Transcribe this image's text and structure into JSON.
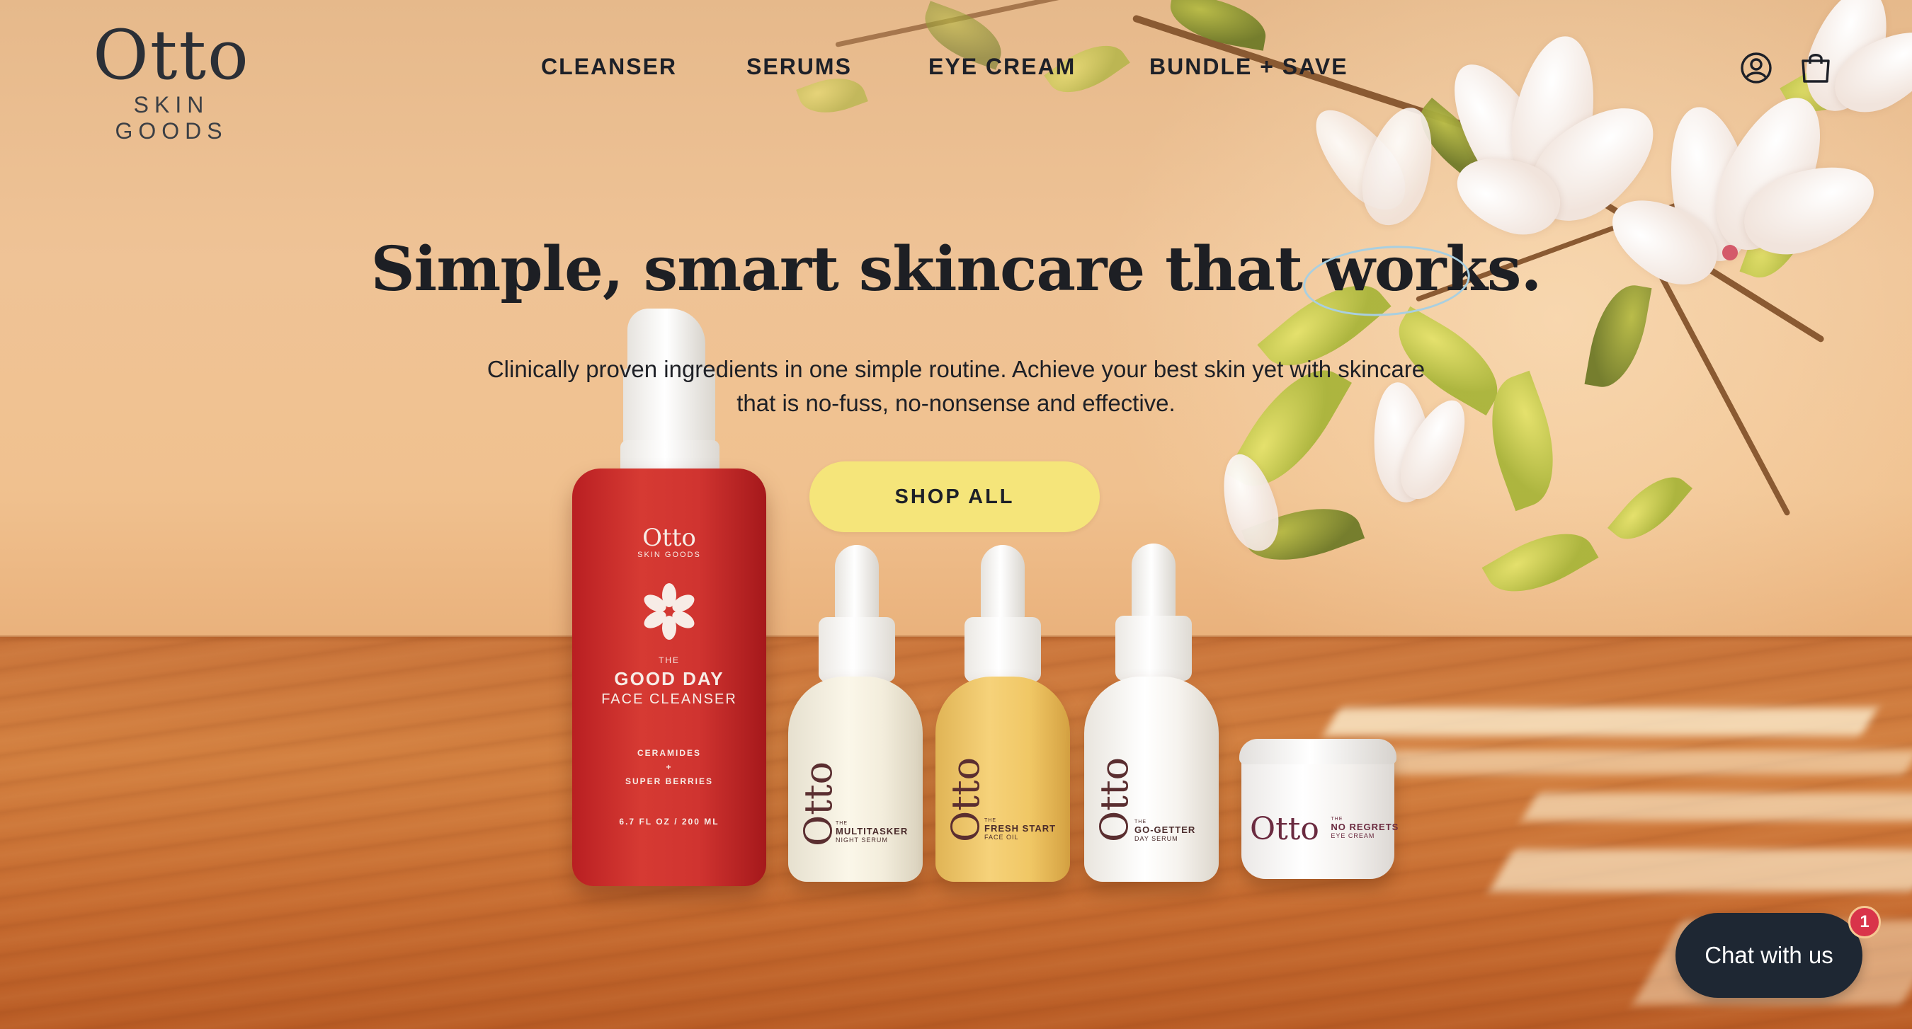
{
  "brand": {
    "name": "Otto",
    "subtitle": "SKIN GOODS"
  },
  "nav": {
    "items": [
      {
        "label": "CLEANSER"
      },
      {
        "label": "SERUMS"
      },
      {
        "label": "EYE CREAM"
      },
      {
        "label": "BUNDLE + SAVE"
      }
    ]
  },
  "header_icons": {
    "account": "account-icon",
    "cart": "shopping-bag-icon"
  },
  "hero": {
    "title_main": "Simple, smart skincare that ",
    "title_highlight": "works",
    "title_end": ".",
    "subtitle_line1": "Clinically proven ingredients in one simple routine. Achieve your best skin yet with skincare",
    "subtitle_line2": "that is no-fuss, no-nonsense and effective.",
    "cta_label": "SHOP ALL"
  },
  "products": {
    "cleanser": {
      "brand": "Otto",
      "brand_sub": "SKIN GOODS",
      "the": "THE",
      "name": "GOOD DAY",
      "type": "FACE CLEANSER",
      "ingredient1": "CERAMIDES",
      "plus": "+",
      "ingredient2": "SUPER BERRIES",
      "volume": "6.7 FL OZ / 200 ML"
    },
    "serums": [
      {
        "brand": "Otto",
        "the": "THE",
        "name": "MULTITASKER",
        "type": "NIGHT SERUM"
      },
      {
        "brand": "Otto",
        "the": "THE",
        "name": "FRESH START",
        "type": "FACE OIL"
      },
      {
        "brand": "Otto",
        "the": "THE",
        "name": "GO-GETTER",
        "type": "DAY SERUM"
      }
    ],
    "eye_cream": {
      "brand": "Otto",
      "the": "THE",
      "name": "NO REGRETS",
      "type": "EYE CREAM"
    }
  },
  "chat": {
    "label": "Chat with us",
    "badge_count": "1"
  },
  "colors": {
    "cta": "#f5e57a",
    "chat_bg": "#1e2733",
    "badge": "#d9344a",
    "highlight_ring": "#a9cfe0",
    "text_dark": "#1d2028"
  }
}
